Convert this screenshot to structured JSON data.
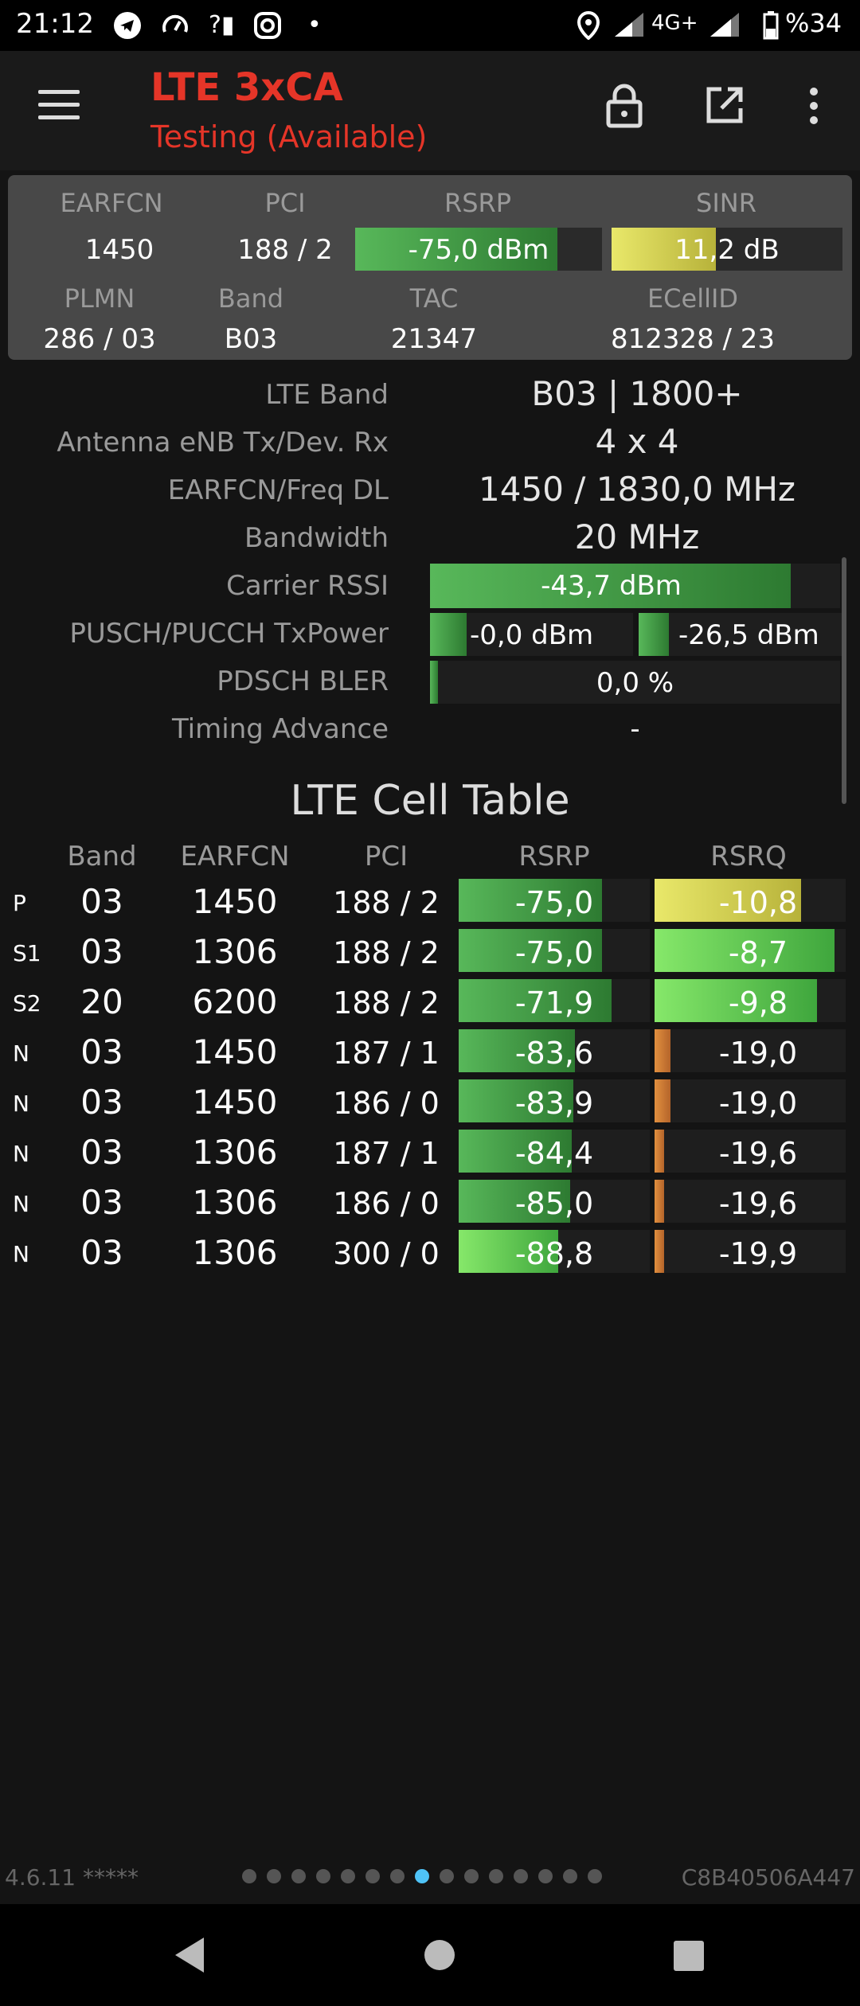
{
  "status": {
    "time": "21:12",
    "network": "4G+",
    "battery": "%34"
  },
  "app": {
    "title": "LTE 3xCA",
    "subtitle": "Testing (Available)"
  },
  "card": {
    "h_earfcn": "EARFCN",
    "h_pci": "PCI",
    "h_rsrp": "RSRP",
    "h_sinr": "SINR",
    "earfcn": "1450",
    "pci": "188 / 2",
    "rsrp": "-75,0 dBm",
    "rsrp_fill": 0.82,
    "sinr": "11,2 dB",
    "sinr_fill": 0.45,
    "h_plmn": "PLMN",
    "h_band": "Band",
    "h_tac": "TAC",
    "h_ecell": "ECellID",
    "plmn": "286 / 03",
    "band": "B03",
    "tac": "21347",
    "ecell": "812328 / 23"
  },
  "details": {
    "lte_band_label": "LTE Band",
    "lte_band": "B03 | 1800+",
    "antenna_label": "Antenna eNB Tx/Dev. Rx",
    "antenna": "4 x 4",
    "earfcn_label": "EARFCN/Freq DL",
    "earfcn": "1450 / 1830,0 MHz",
    "bw_label": "Bandwidth",
    "bw": "20 MHz",
    "rssi_label": "Carrier RSSI",
    "rssi": "-43,7 dBm",
    "tx_label": "PUSCH/PUCCH TxPower",
    "pusch": "-0,0 dBm",
    "pucch": "-26,5 dBm",
    "bler_label": "PDSCH BLER",
    "bler": "0,0 %",
    "ta_label": "Timing Advance",
    "ta": "-"
  },
  "table": {
    "title": "LTE Cell Table",
    "headers": {
      "band": "Band",
      "earfcn": "EARFCN",
      "pci": "PCI",
      "rsrp": "RSRP",
      "rsrq": "RSRQ"
    },
    "rows": [
      {
        "type": "P",
        "band": "03",
        "earfcn": "1450",
        "pci": "188 / 2",
        "rsrp": "-75,0",
        "rsrq": "-10,8"
      },
      {
        "type": "S1",
        "band": "03",
        "earfcn": "1306",
        "pci": "188 / 2",
        "rsrp": "-75,0",
        "rsrq": "-8,7"
      },
      {
        "type": "S2",
        "band": "20",
        "earfcn": "6200",
        "pci": "188 / 2",
        "rsrp": "-71,9",
        "rsrq": "-9,8"
      },
      {
        "type": "N",
        "band": "03",
        "earfcn": "1450",
        "pci": "187 / 1",
        "rsrp": "-83,6",
        "rsrq": "-19,0"
      },
      {
        "type": "N",
        "band": "03",
        "earfcn": "1450",
        "pci": "186 / 0",
        "rsrp": "-83,9",
        "rsrq": "-19,0"
      },
      {
        "type": "N",
        "band": "03",
        "earfcn": "1306",
        "pci": "187 / 1",
        "rsrp": "-84,4",
        "rsrq": "-19,6"
      },
      {
        "type": "N",
        "band": "03",
        "earfcn": "1306",
        "pci": "186 / 0",
        "rsrp": "-85,0",
        "rsrq": "-19,6"
      },
      {
        "type": "N",
        "band": "03",
        "earfcn": "1306",
        "pci": "300 / 0",
        "rsrp": "-88,8",
        "rsrq": "-19,9"
      }
    ]
  },
  "footer": {
    "version": "4.6.11 *****",
    "device": "C8B40506A447"
  }
}
